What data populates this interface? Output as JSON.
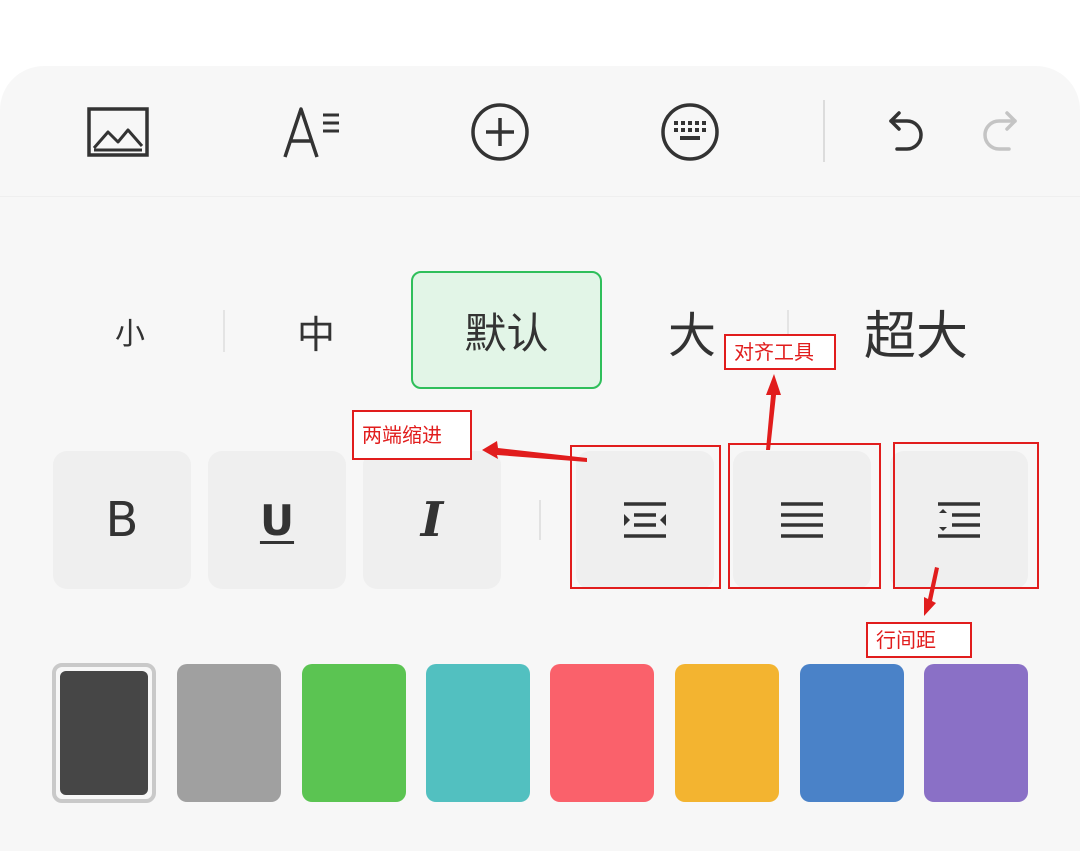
{
  "toolbar": {
    "icons": [
      "image-icon",
      "text-format-icon",
      "add-circle-icon",
      "keyboard-icon",
      "undo-icon",
      "redo-icon"
    ]
  },
  "font_size": {
    "options": [
      "小",
      "中",
      "默认",
      "大",
      "超大"
    ],
    "selected": "默认"
  },
  "format": {
    "bold": "B",
    "underline": "U",
    "italic": "I"
  },
  "colors": {
    "swatches": [
      "#464646",
      "#a0a0a0",
      "#5bc452",
      "#52c0c0",
      "#fa616b",
      "#f3b430",
      "#4a82c8",
      "#8a70c6"
    ],
    "selected_index": 0,
    "selected_tint": "#e2f5e7",
    "accent": "#2fbf5b"
  },
  "annotations": {
    "indent": "两端缩进",
    "align": "对齐工具",
    "line_spacing": "行间距",
    "color": "#e11d1d"
  }
}
